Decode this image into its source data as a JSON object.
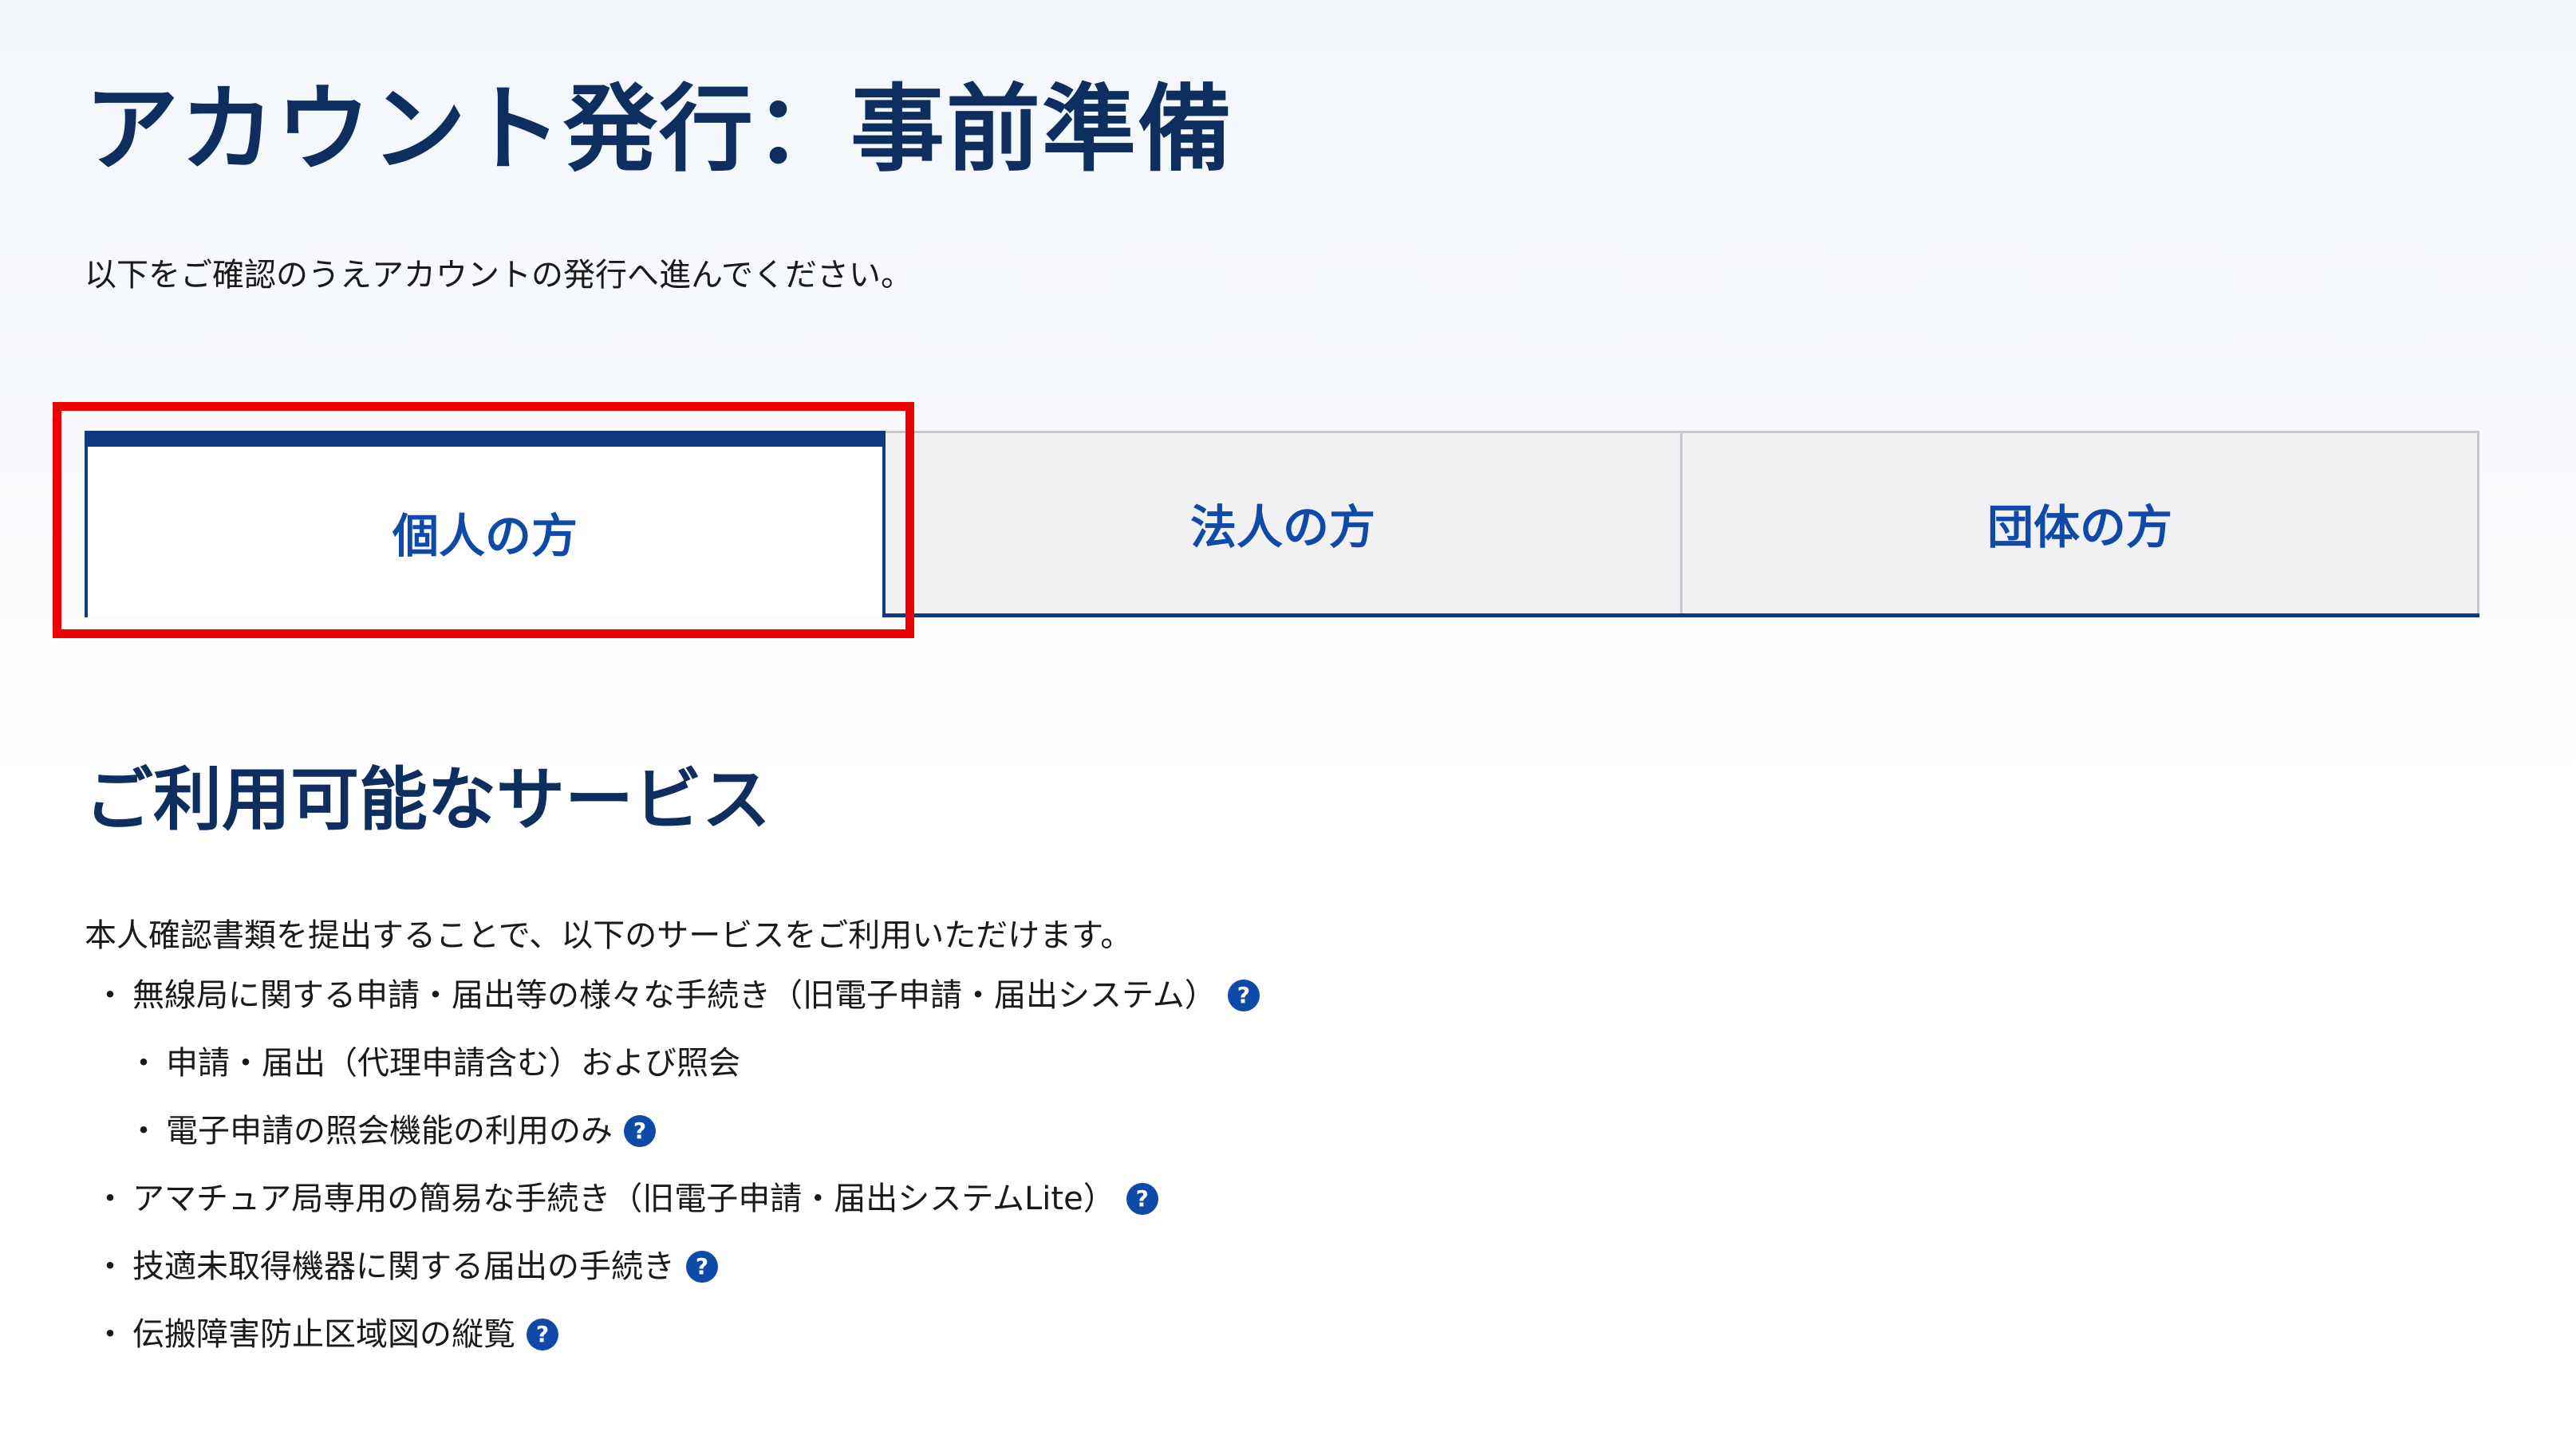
{
  "header": {
    "title": "アカウント発行：事前準備",
    "intro": "以下をご確認のうえアカウントの発行へ進んでください。"
  },
  "tabs": [
    {
      "label": "個人の方",
      "active": true
    },
    {
      "label": "法人の方",
      "active": false
    },
    {
      "label": "団体の方",
      "active": false
    }
  ],
  "services": {
    "title": "ご利用可能なサービス",
    "description": "本人確認書類を提出することで、以下のサービスをご利用いただけます。",
    "bullet": "・",
    "items": [
      {
        "text": "無線局に関する申請・届出等の様々な手続き（旧電子申請・届出システム）",
        "help": true,
        "level": 0
      },
      {
        "text": "申請・届出（代理申請含む）および照会",
        "help": false,
        "level": 1
      },
      {
        "text": "電子申請の照会機能の利用のみ",
        "help": true,
        "level": 1
      },
      {
        "text": "アマチュア局専用の簡易な手続き（旧電子申請・届出システムLite）",
        "help": true,
        "level": 0
      },
      {
        "text": "技適未取得機器に関する届出の手続き",
        "help": true,
        "level": 0
      },
      {
        "text": "伝搬障害防止区域図の縦覧",
        "help": true,
        "level": 0
      }
    ],
    "help_icon_glyph": "?"
  },
  "colors": {
    "heading": "#0d2e5e",
    "accent": "#0f4aa8",
    "tab_border": "#0d3a80",
    "highlight": "#ee0000"
  }
}
